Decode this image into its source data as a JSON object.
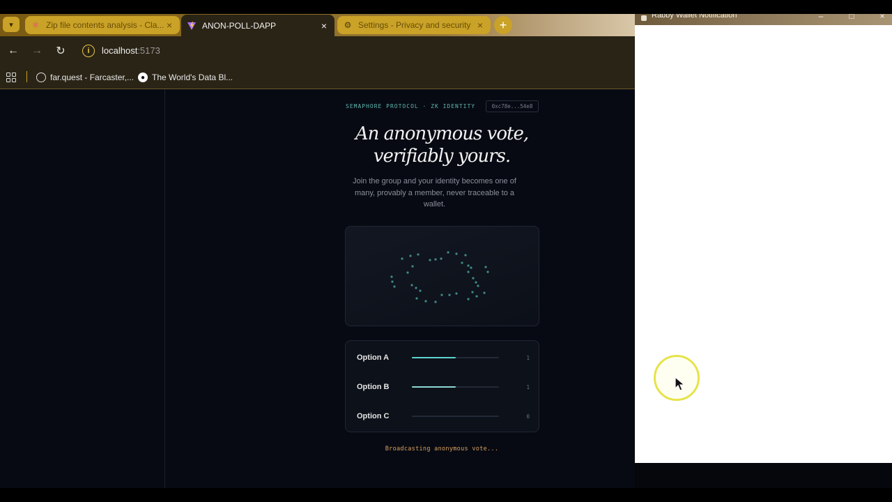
{
  "browser": {
    "tabs": [
      {
        "title": "Zip file contents analysis - Cla...",
        "icon": "claude-icon",
        "active": false
      },
      {
        "title": "ANON-POLL-DAPP",
        "icon": "vite-icon",
        "active": true
      },
      {
        "title": "Settings - Privacy and security",
        "icon": "gear-icon",
        "active": false
      }
    ],
    "new_tab_label": "+",
    "address": {
      "host": "localhost",
      "port": ":5173"
    },
    "bookmarks": [
      {
        "label": "far.quest - Farcaster,...",
        "icon": "globe-icon"
      },
      {
        "label": "The World's Data Bl...",
        "icon": "octopus-icon"
      }
    ]
  },
  "app": {
    "eyebrow": "SEMAPHORE PROTOCOL · ZK IDENTITY",
    "address_chip": "0xc78e...54e8",
    "headline_line1": "An anonymous vote,",
    "headline_line2": "verifiably yours.",
    "subtext": "Join the group and your identity becomes one of many, provably a member, never traceable to a wallet.",
    "options": [
      {
        "label": "Option A",
        "count": "1",
        "share": 0.5
      },
      {
        "label": "Option B",
        "count": "1",
        "share": 0.5
      },
      {
        "label": "Option C",
        "count": "0",
        "share": 0
      }
    ],
    "status": "Broadcasting anonymous vote..."
  },
  "rabby": {
    "title": "Rabby Wallet Notification"
  },
  "colors": {
    "accent": "#5ed3d0",
    "status": "#d9a060",
    "tab_gold": "#c9a227"
  }
}
